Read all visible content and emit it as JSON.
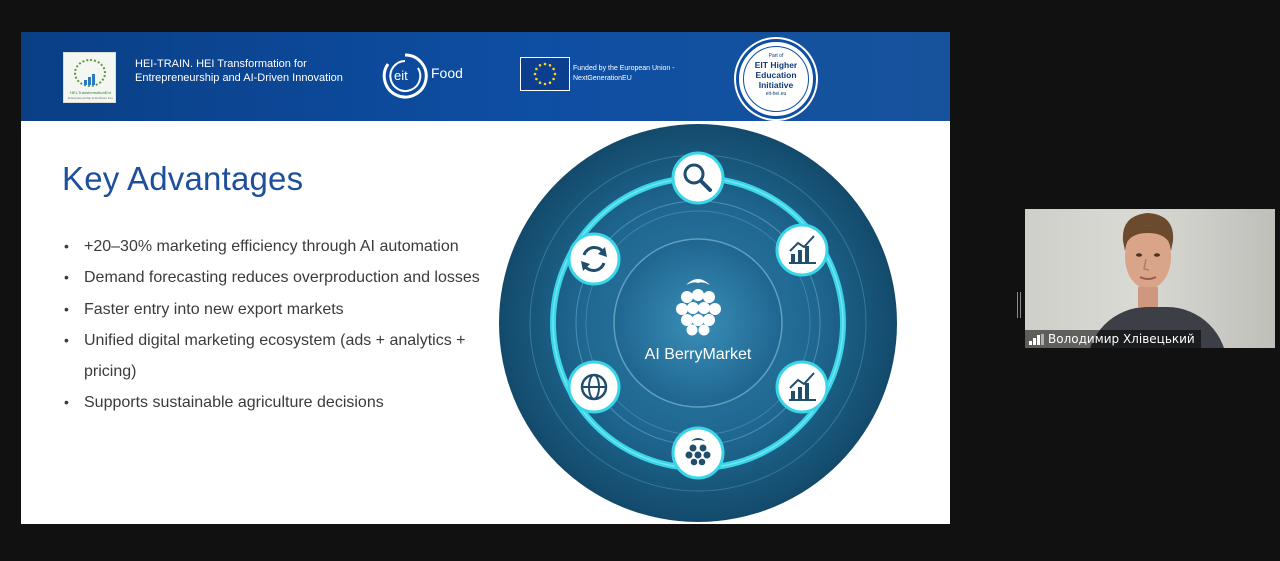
{
  "slide": {
    "header": {
      "hei_logo_caption": "HEI-TransformationEnt",
      "hei_logo_subcaption": "Entrepreneurship & AI-Driven Innovation",
      "hei_title_line1": "HEI-TRAIN. HEI Transformation for",
      "hei_title_line2": "Entrepreneurship and AI-Driven Innovation",
      "eit_text": "eit",
      "food_text": "Food",
      "eu_line1": "Funded by the European Union -",
      "eu_line2": "NextGenerationEU",
      "badge_small": "Part of",
      "badge_main": "EIT Higher Education Initiative",
      "badge_url": "eit-hei.eu"
    },
    "title": "Key Advantages",
    "bullets": [
      "+20–30% marketing efficiency through AI automation",
      "Demand forecasting reduces overproduction and losses",
      "Faster entry into new export markets",
      "Unified digital marketing ecosystem (ads + analytics + pricing)",
      "Supports sustainable agriculture decisions"
    ],
    "graphic": {
      "center_label": "AI BerryMarket",
      "icons": [
        "search-icon",
        "chart-icon",
        "chart-icon",
        "raspberry-icon",
        "globe-icon",
        "refresh-icon"
      ]
    }
  },
  "participant": {
    "name": "Володимир Хлівецький"
  },
  "colors": {
    "background": "#111111",
    "header_blue": "#0e4ea3",
    "title_blue": "#1d4f9a",
    "body_text": "#3b3b3b",
    "graphic_bg": "#1b5d82",
    "ring_cyan": "#39d5e8"
  }
}
